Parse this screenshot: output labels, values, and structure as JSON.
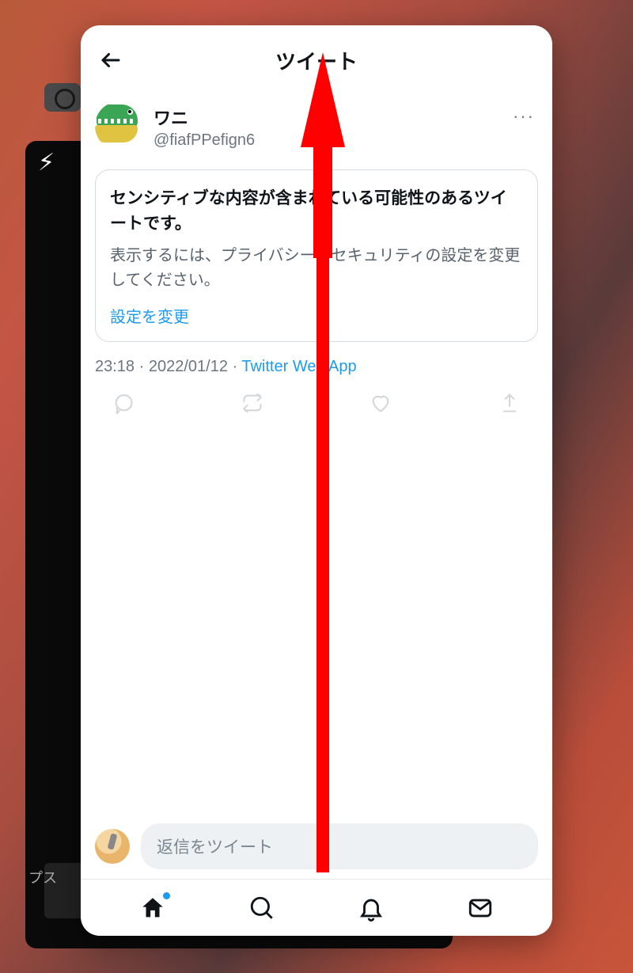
{
  "background": {
    "camera_flash": "⚡︎",
    "apps_label": "プス"
  },
  "header": {
    "title": "ツイート"
  },
  "tweet": {
    "display_name": "ワニ",
    "handle": "@fiafPPefign6",
    "sensitive": {
      "title": "センシティブな内容が含まれている可能性のあるツイートです。",
      "description": "表示するには、プライバシーとセキュリティの設定を変更してください。",
      "link_label": "設定を変更"
    },
    "timestamp": {
      "time": "23:18",
      "date": "2022/01/12",
      "source": "Twitter Web App"
    }
  },
  "composer": {
    "placeholder": "返信をツイート"
  },
  "icons": {
    "back": "back-arrow",
    "more": "···",
    "reply": "reply-icon",
    "retweet": "retweet-icon",
    "like": "like-icon",
    "share": "share-icon",
    "home": "home-icon",
    "search": "search-icon",
    "bell": "notifications-icon",
    "mail": "messages-icon",
    "flip": "camera-flip-icon"
  },
  "annotation": {
    "arrow_color": "#ff0000"
  }
}
